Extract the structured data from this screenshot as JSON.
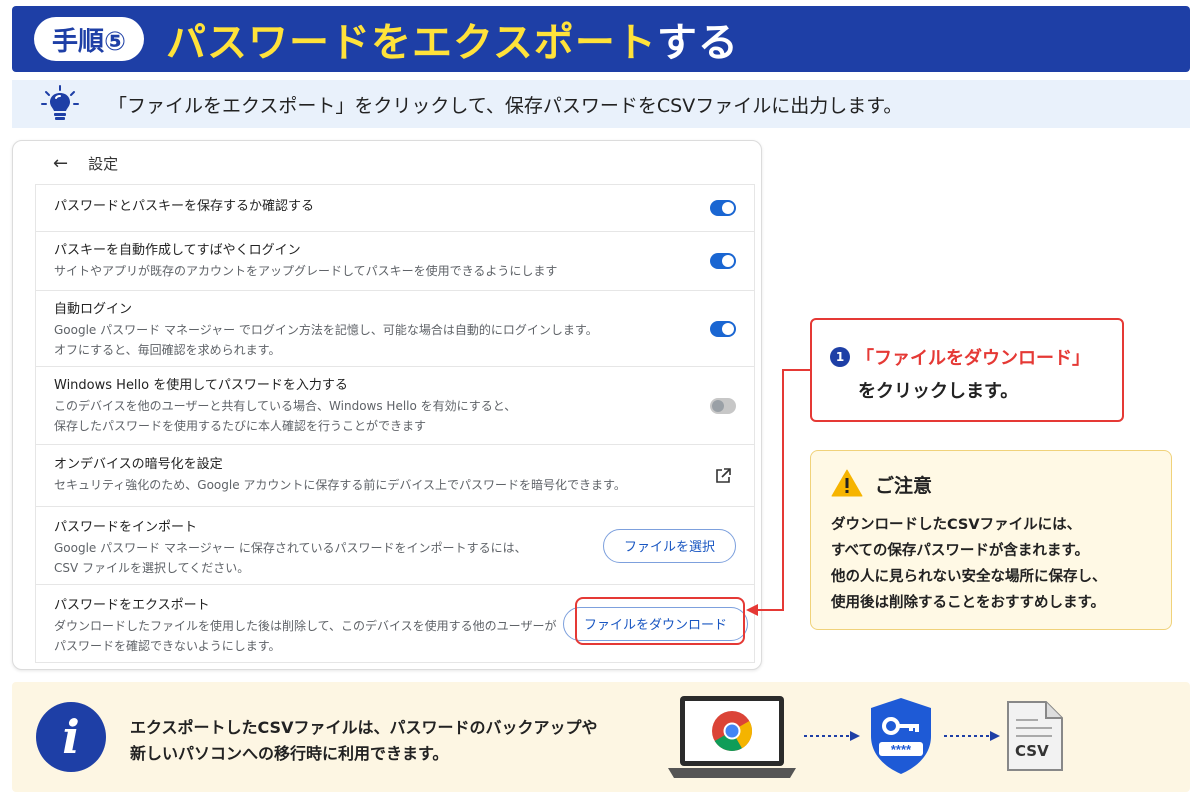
{
  "header": {
    "step_label": "手順⑤",
    "title_main": "パスワードをエクスポート",
    "title_suffix": "する"
  },
  "instruction": {
    "text": "「ファイルをエクスポート」をクリックして、保存パスワードをCSVファイルに出力します。"
  },
  "panel": {
    "back_label": "設定",
    "rows": [
      {
        "title": "パスワードとパスキーを保存するか確認する",
        "desc": [],
        "control": "toggle",
        "toggle_on": true
      },
      {
        "title": "パスキーを自動作成してすばやくログイン",
        "desc": [
          "サイトやアプリが既存のアカウントをアップグレードしてパスキーを使用できるようにします"
        ],
        "control": "toggle",
        "toggle_on": true
      },
      {
        "title": "自動ログイン",
        "desc": [
          "Google パスワード マネージャー でログイン方法を記憶し、可能な場合は自動的にログインします。",
          "オフにすると、毎回確認を求められます。"
        ],
        "control": "toggle",
        "toggle_on": true
      },
      {
        "title": "Windows Hello を使用してパスワードを入力する",
        "desc": [
          "このデバイスを他のユーザーと共有している場合、Windows Hello を有効にすると、",
          "保存したパスワードを使用するたびに本人確認を行うことができます"
        ],
        "control": "toggle",
        "toggle_on": false
      },
      {
        "title": "オンデバイスの暗号化を設定",
        "desc": [
          "セキュリティ強化のため、Google アカウントに保存する前にデバイス上でパスワードを暗号化できます。"
        ],
        "control": "external-link"
      },
      {
        "title": "パスワードをインポート",
        "desc": [
          "Google パスワード マネージャー に保存されているパスワードをインポートするには、",
          "CSV ファイルを選択してください。"
        ],
        "control": "button",
        "button_label": "ファイルを選択"
      },
      {
        "title": "パスワードをエクスポート",
        "desc": [
          "ダウンロードしたファイルを使用した後は削除して、このデバイスを使用する他のユーザーが",
          "パスワードを確認できないようにします。"
        ],
        "control": "button",
        "button_label": "ファイルをダウンロード"
      }
    ]
  },
  "callout": {
    "number": "1",
    "line1": "「ファイルをダウンロード」",
    "line2": "をクリックします。"
  },
  "caution": {
    "title": "ご注意",
    "lines": [
      "ダウンロードしたCSVファイルには、",
      "すべての保存パスワードが含まれます。",
      "他の人に見られない安全な場所に保存し、",
      "使用後は削除することをおすすめします。"
    ]
  },
  "info": {
    "lines": [
      "エクスポートしたCSVファイルは、パスワードのバックアップや",
      "新しいパソコンへの移行時に利用できます。"
    ],
    "shield_mask": "****",
    "csv_label": "CSV"
  },
  "colors": {
    "brand_blue": "#1e3fa6",
    "title_yellow": "#ffe23a",
    "alert_red": "#e53935",
    "toggle_blue": "#1a66d2"
  },
  "icons": [
    "lightbulb-icon",
    "back-arrow-icon",
    "external-link-icon",
    "warning-icon",
    "info-icon",
    "chrome-icon",
    "key-shield-icon",
    "csv-file-icon"
  ]
}
